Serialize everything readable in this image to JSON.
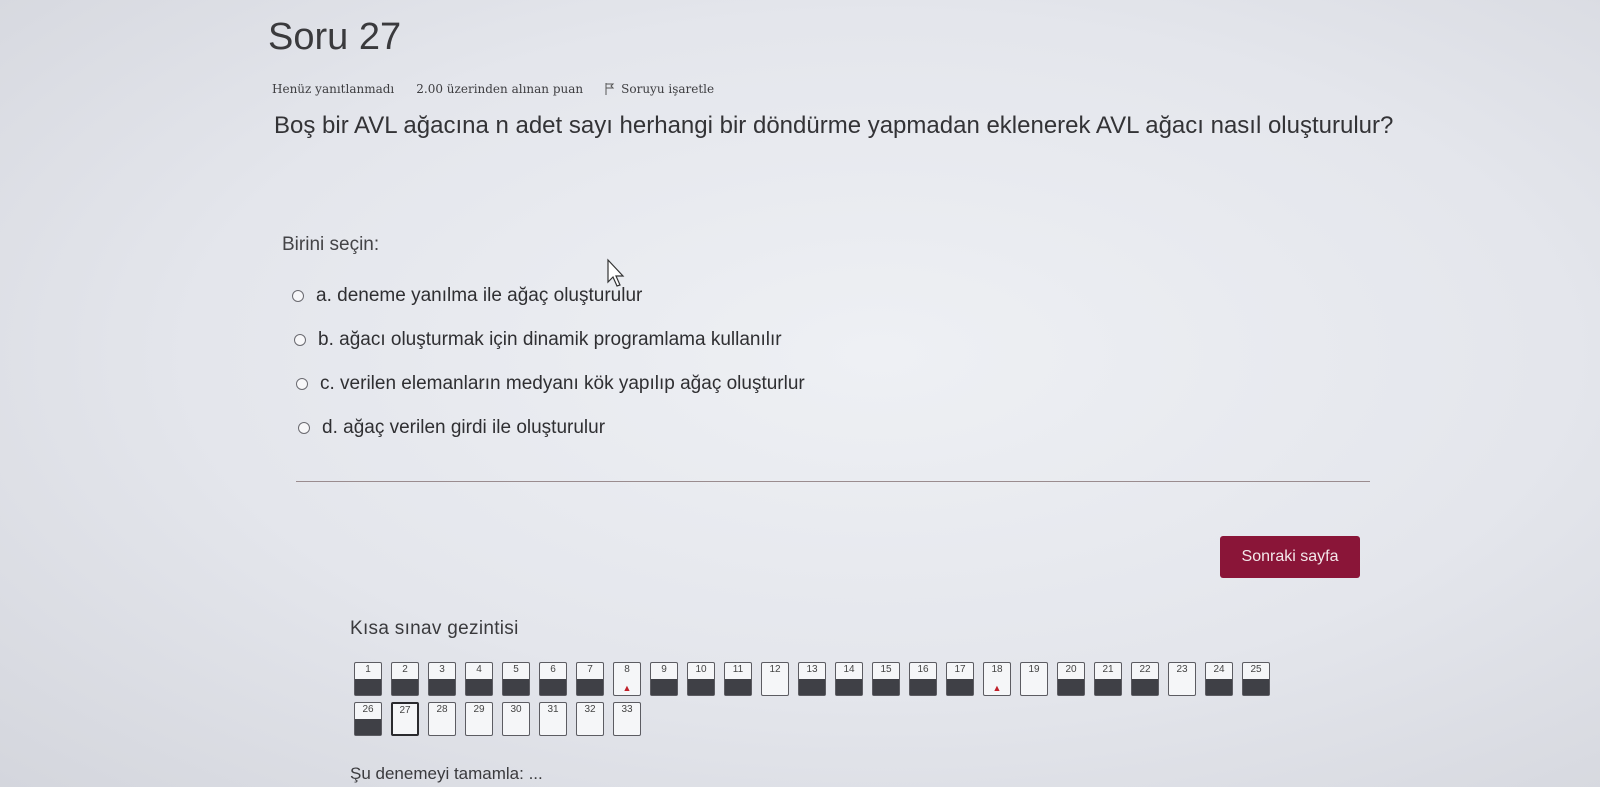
{
  "question": {
    "title": "Soru 27",
    "status": "Henüz yanıtlanmadı",
    "grade": "2.00 üzerinden alınan puan",
    "flag_label": "Soruyu işaretle",
    "text": "Boş bir AVL ağacına n adet sayı herhangi bir döndürme yapmadan eklenerek AVL ağacı nasıl oluşturulur?",
    "prompt": "Birini seçin:",
    "answers": [
      "a. deneme yanılma ile ağaç oluşturulur",
      "b. ağacı oluşturmak için dinamik programlama kullanılır",
      "c. verilen elemanların medyanı kök yapılıp ağaç oluşturlur",
      "d. ağaç verilen girdi ile oluşturulur"
    ]
  },
  "next_button": "Sonraki sayfa",
  "navigation": {
    "title": "Kısa sınav gezintisi",
    "row1": [
      "1",
      "2",
      "3",
      "4",
      "5",
      "6",
      "7",
      "8",
      "9",
      "10",
      "11",
      "12",
      "13",
      "14",
      "15",
      "16",
      "17",
      "18",
      "19",
      "20",
      "21",
      "22",
      "23",
      "24",
      "25"
    ],
    "row2": [
      "26",
      "27",
      "28",
      "29",
      "30",
      "31",
      "32",
      "33"
    ]
  },
  "finish_link": "Şu denemeyi tamamla: ...",
  "colors": {
    "accent": "#8a1538",
    "answered": "#3f4046",
    "flag": "#c0202a"
  },
  "icons": {
    "flag": "flag-icon",
    "radio": "radio-icon",
    "cursor": "mouse-cursor-icon"
  }
}
